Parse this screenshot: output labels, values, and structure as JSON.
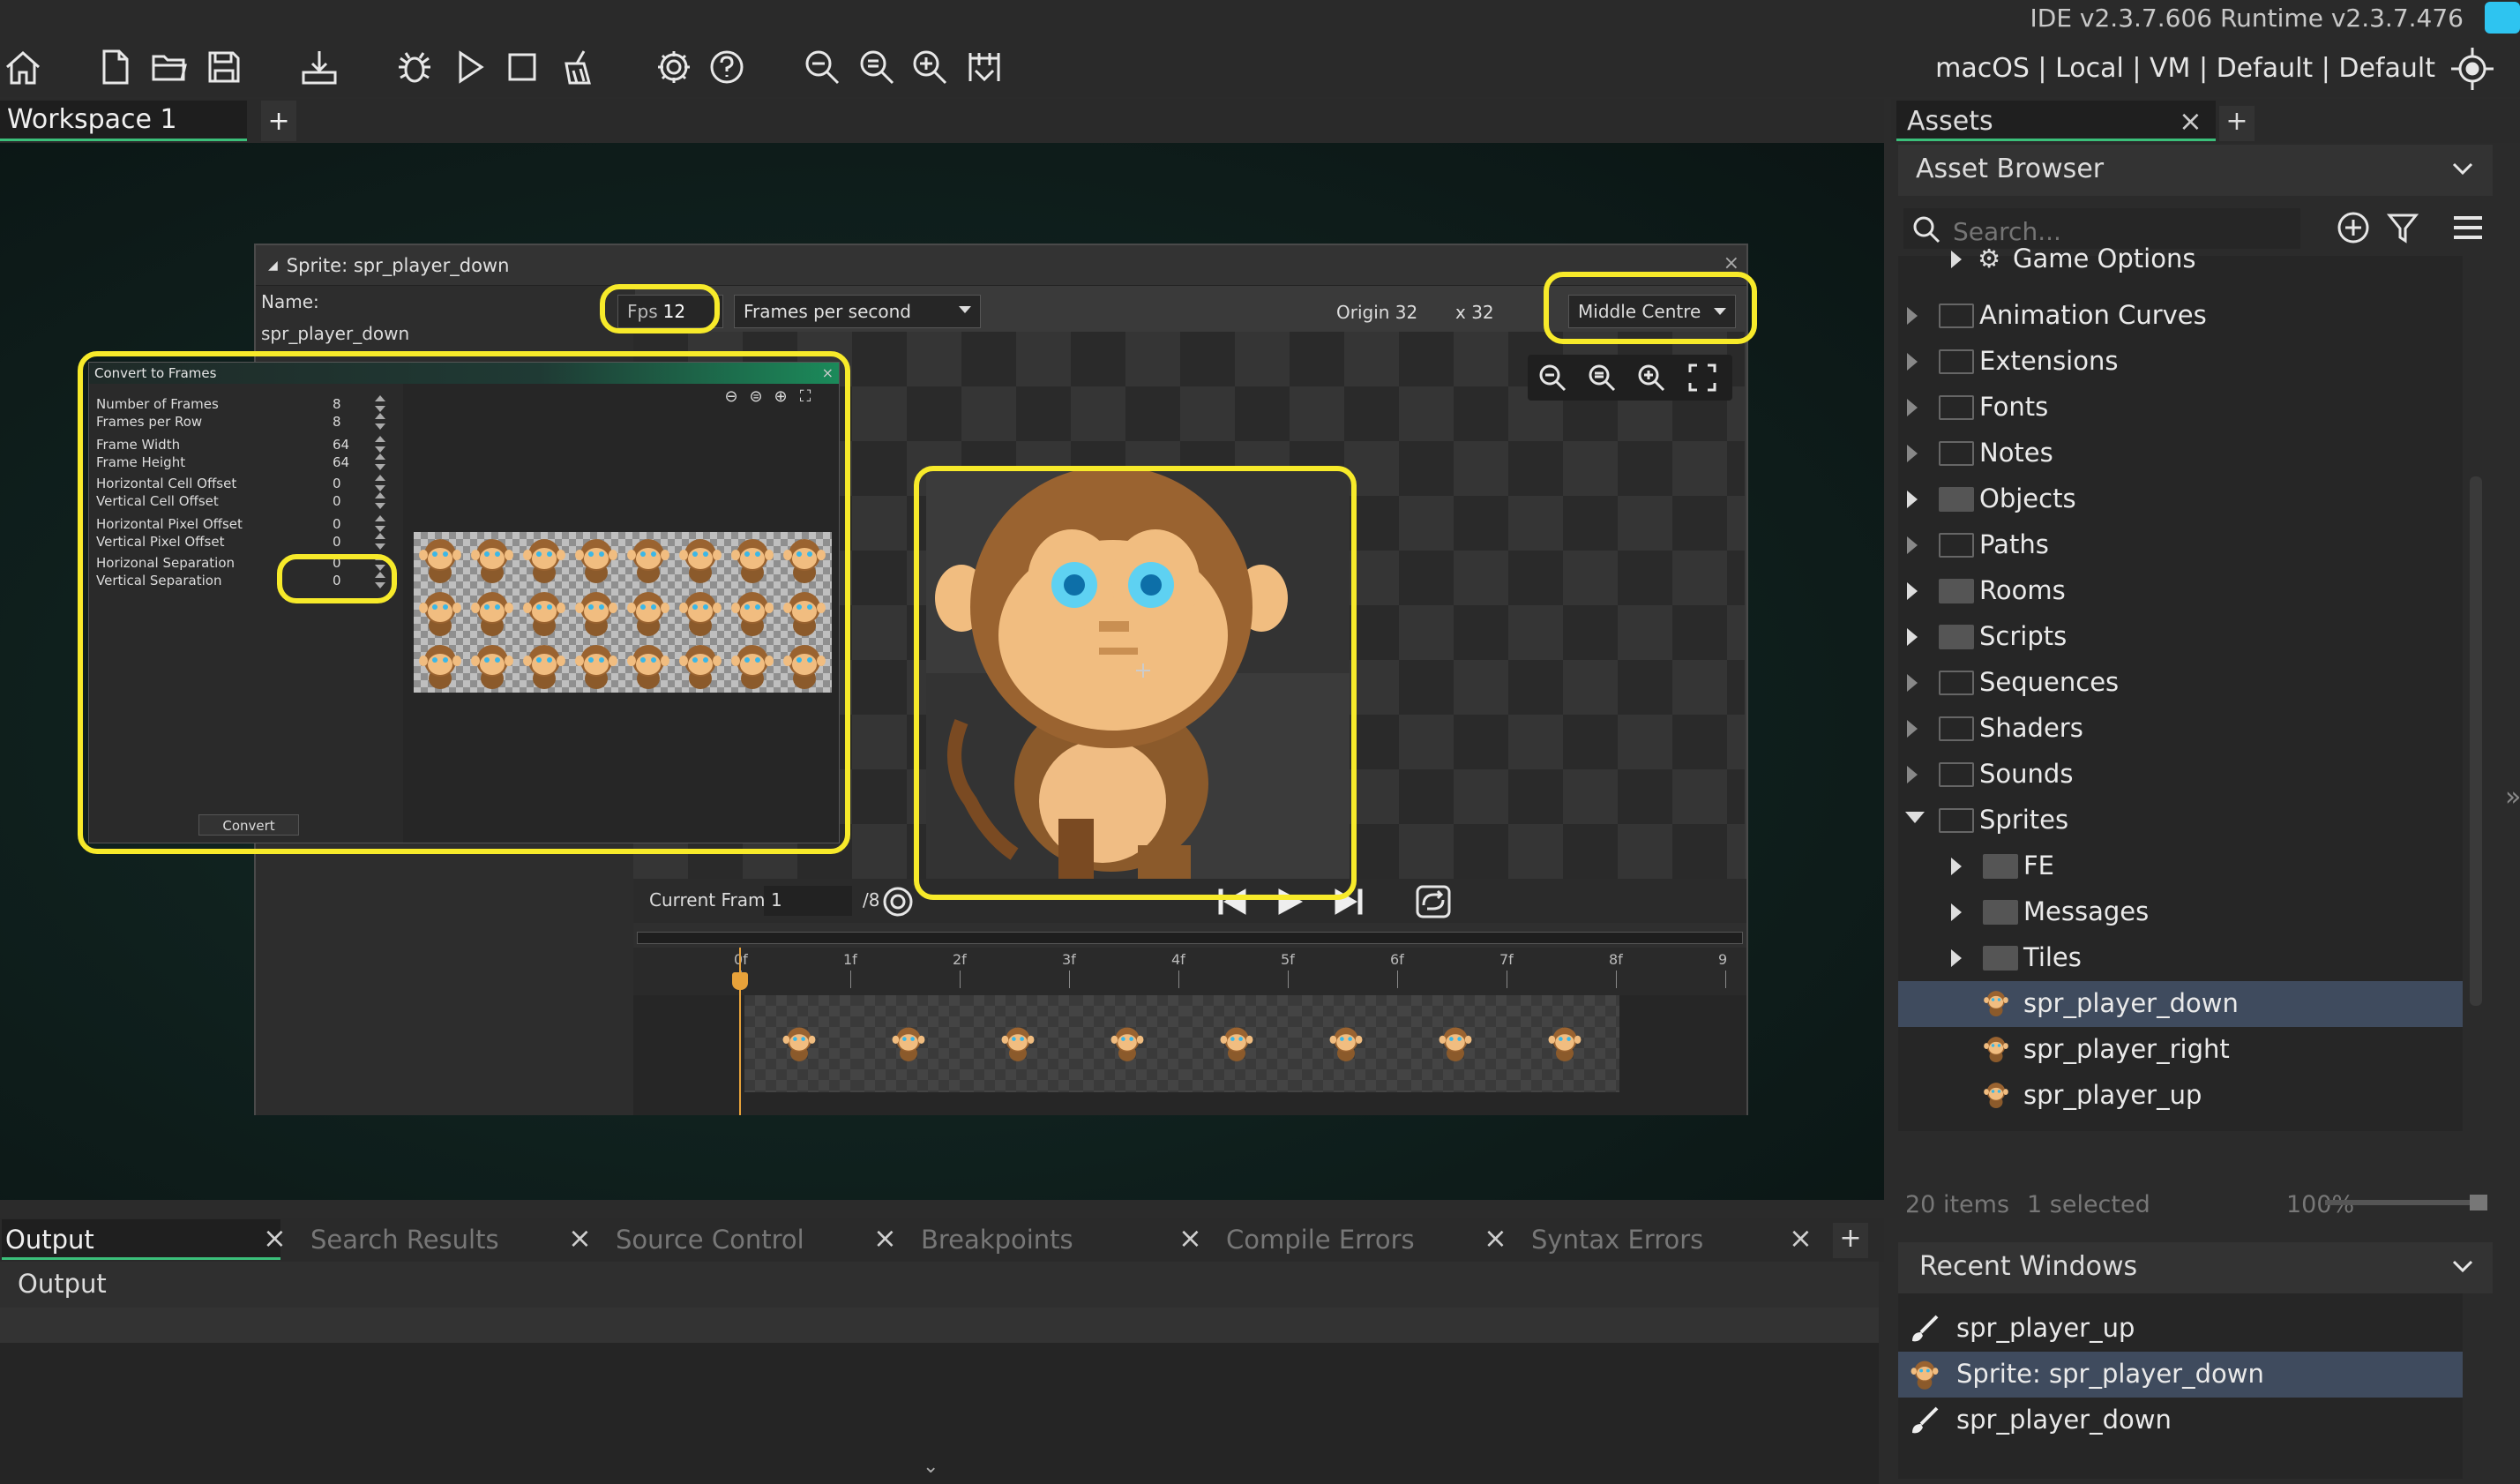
{
  "header": {
    "version": "IDE v2.3.7.606  Runtime v2.3.7.476",
    "target": "macOS | Local | VM | Default | Default"
  },
  "toolbar": {
    "icons": [
      "home-icon",
      "new-file-icon",
      "open-folder-icon",
      "save-icon",
      "create-exe-icon",
      "debug-icon",
      "run-icon",
      "stop-icon",
      "clean-icon",
      "settings-icon",
      "help-icon",
      "zoom-out-icon",
      "zoom-reset-icon",
      "zoom-in-icon",
      "game-options-icon"
    ]
  },
  "workspace": {
    "tab_label": "Workspace 1",
    "add_label": "+"
  },
  "sprite_editor": {
    "title": "Sprite: spr_player_down",
    "close": "×",
    "name_label": "Name:",
    "name_value": "spr_player_down",
    "fps_label": "Fps",
    "fps_value": "12",
    "fps_mode": "Frames per second",
    "origin_label": "Origin 32",
    "origin_y": "x 32",
    "origin_preset": "Middle Centre",
    "current_frame_label": "Current Frame:",
    "current_frame_value": "1",
    "frame_total": "/8",
    "timeline_ticks": [
      "0f",
      "1f",
      "2f",
      "3f",
      "4f",
      "5f",
      "6f",
      "7f",
      "8f",
      "9"
    ],
    "frame_count": 8
  },
  "convert_dialog": {
    "title": "Convert to Frames",
    "close": "×",
    "fields": [
      {
        "label": "Number of Frames",
        "value": "8"
      },
      {
        "label": "Frames per Row",
        "value": "8"
      },
      {
        "label": "Frame Width",
        "value": "64"
      },
      {
        "label": "Frame Height",
        "value": "64"
      },
      {
        "label": "Horizontal Cell Offset",
        "value": "0"
      },
      {
        "label": "Vertical Cell Offset",
        "value": "0"
      },
      {
        "label": "Horizontal Pixel Offset",
        "value": "0"
      },
      {
        "label": "Vertical Pixel Offset",
        "value": "0"
      },
      {
        "label": "Horizonal Separation",
        "value": "0"
      },
      {
        "label": "Vertical Separation",
        "value": "0"
      }
    ],
    "convert_label": "Convert"
  },
  "assets": {
    "tab_label": "Assets",
    "close": "×",
    "add_label": "+",
    "browser_title": "Asset Browser",
    "search_placeholder": "Search...",
    "tree": [
      {
        "label": "Game Options",
        "kind": "options",
        "indent": 1
      },
      {
        "label": "Animation Curves",
        "kind": "folder",
        "indent": 0
      },
      {
        "label": "Extensions",
        "kind": "folder",
        "indent": 0
      },
      {
        "label": "Fonts",
        "kind": "folder",
        "indent": 0
      },
      {
        "label": "Notes",
        "kind": "folder",
        "indent": 0
      },
      {
        "label": "Objects",
        "kind": "folder-filled",
        "indent": 0
      },
      {
        "label": "Paths",
        "kind": "folder",
        "indent": 0
      },
      {
        "label": "Rooms",
        "kind": "folder-filled",
        "indent": 0
      },
      {
        "label": "Scripts",
        "kind": "folder-filled",
        "indent": 0
      },
      {
        "label": "Sequences",
        "kind": "folder",
        "indent": 0
      },
      {
        "label": "Shaders",
        "kind": "folder",
        "indent": 0
      },
      {
        "label": "Sounds",
        "kind": "folder",
        "indent": 0
      },
      {
        "label": "Sprites",
        "kind": "folder-open",
        "indent": 0
      },
      {
        "label": "FE",
        "kind": "folder-filled",
        "indent": 1
      },
      {
        "label": "Messages",
        "kind": "folder-filled",
        "indent": 1
      },
      {
        "label": "Tiles",
        "kind": "folder-filled",
        "indent": 1
      },
      {
        "label": "spr_player_down",
        "kind": "sprite",
        "indent": 1,
        "selected": true
      },
      {
        "label": "spr_player_right",
        "kind": "sprite",
        "indent": 1
      },
      {
        "label": "spr_player_up",
        "kind": "sprite",
        "indent": 1
      }
    ],
    "items_count": "20 items",
    "selected_count": "1 selected",
    "zoom": "100%"
  },
  "recent_windows": {
    "title": "Recent Windows",
    "items": [
      {
        "label": "spr_player_up",
        "icon": "brush-icon"
      },
      {
        "label": "Sprite: spr_player_down",
        "icon": "sprite-icon",
        "selected": true
      },
      {
        "label": "spr_player_down",
        "icon": "brush-icon"
      }
    ]
  },
  "output": {
    "tabs": [
      "Output",
      "Search Results",
      "Source Control",
      "Breakpoints",
      "Compile Errors",
      "Syntax Errors"
    ],
    "close": "×",
    "add_label": "+",
    "header": "Output"
  },
  "colors": {
    "accent": "#3bbf7a",
    "highlight": "#f7ea2a",
    "selection": "#3f4b5e"
  }
}
